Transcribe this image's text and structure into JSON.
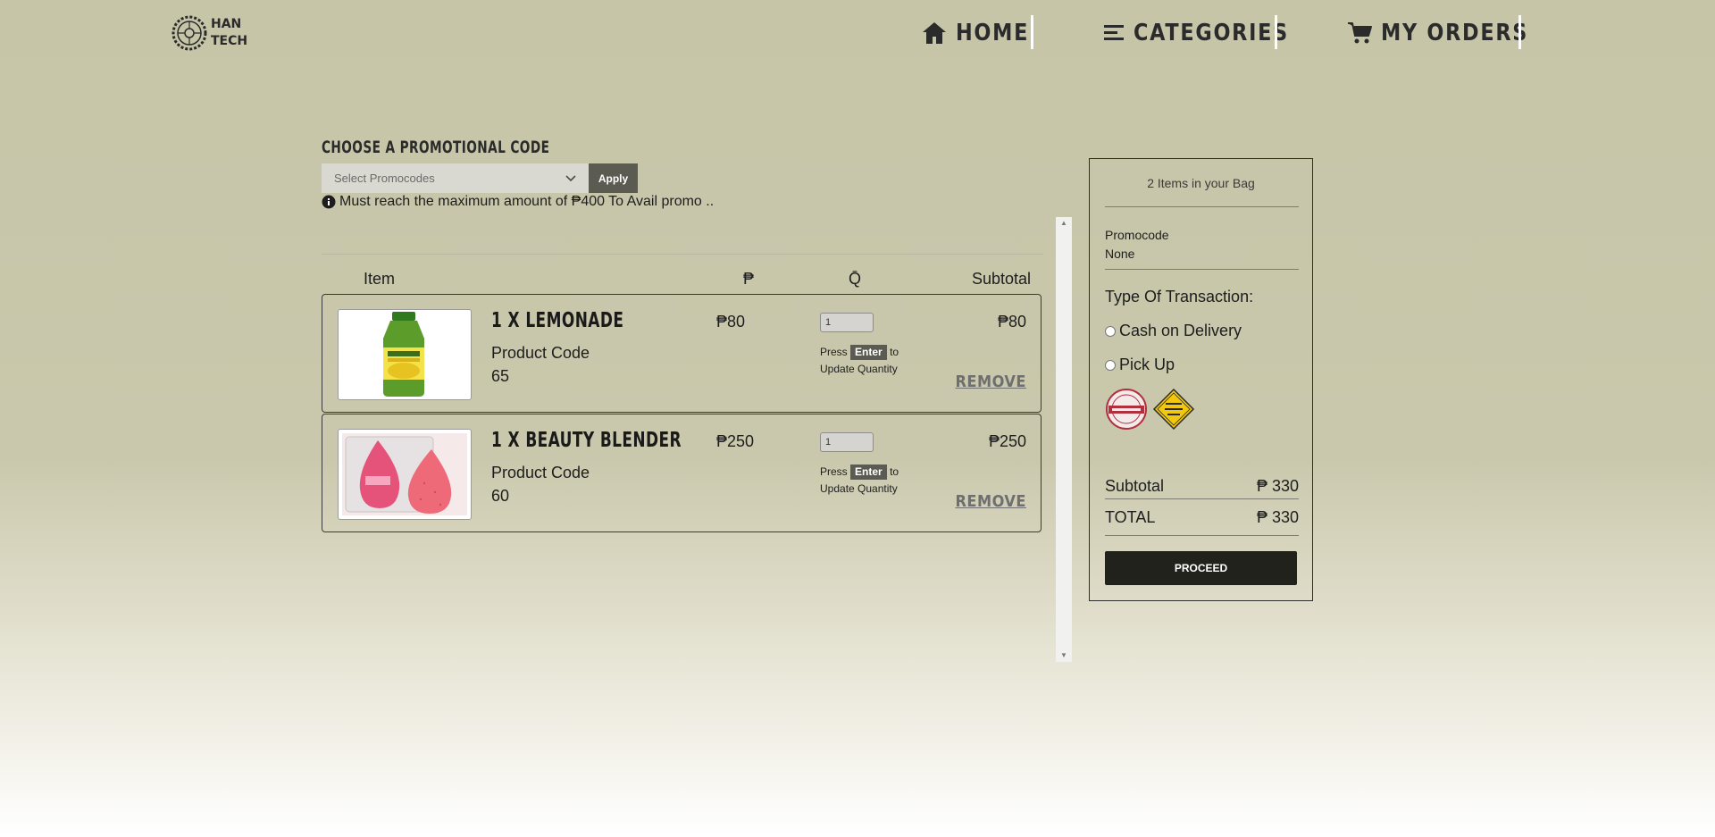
{
  "brand": {
    "line1": "HAN",
    "line2": "TECH"
  },
  "nav": {
    "home": "HOME",
    "categories": "CATEGORIES",
    "orders": "MY ORDERS"
  },
  "promo": {
    "title": "CHOOSE A PROMOTIONAL CODE",
    "select_placeholder": "Select Promocodes",
    "apply_label": "Apply",
    "note": "Must reach the maximum amount of ₱400 To Avail promo .."
  },
  "table": {
    "headers": {
      "item": "Item",
      "price": "₱",
      "qty": "Q̄",
      "subtotal": "Subtotal"
    },
    "rows": [
      {
        "name": "1 X LEMONADE",
        "code_label": "Product Code",
        "code": "65",
        "price": "₱80",
        "qty": "1",
        "hint_press": "Press",
        "hint_key": "Enter",
        "hint_to": "to",
        "hint_rest": "Update Quantity",
        "subtotal": "₱80",
        "remove": "REMOVE"
      },
      {
        "name": "1 X BEAUTY BLENDER",
        "code_label": "Product Code",
        "code": "60",
        "price": "₱250",
        "qty": "1",
        "hint_press": "Press",
        "hint_key": "Enter",
        "hint_to": "to",
        "hint_rest": "Update Quantity",
        "subtotal": "₱250",
        "remove": "REMOVE"
      }
    ]
  },
  "summary": {
    "count": "2 Items in your Bag",
    "promocode_label": "Promocode",
    "promocode_value": "None",
    "transaction_label": "Type Of Transaction:",
    "option_cod": "Cash on Delivery",
    "option_pickup": "Pick Up",
    "subtotal_label": "Subtotal",
    "subtotal_value": "₱ 330",
    "total_label": "TOTAL",
    "total_value": "₱ 330",
    "proceed_label": "PROCEED"
  },
  "colors": {
    "background": "#c7c5a8",
    "button_dark": "#22221d",
    "apply_button": "#5b5b52",
    "nav_separator": "#ffffff"
  },
  "icons": [
    "tire-logo-icon",
    "home-icon",
    "menu-lines-icon",
    "cart-icon",
    "info-icon",
    "chevron-down-icon",
    "cash-on-delivery-badge-icon",
    "pickup-badge-icon"
  ]
}
